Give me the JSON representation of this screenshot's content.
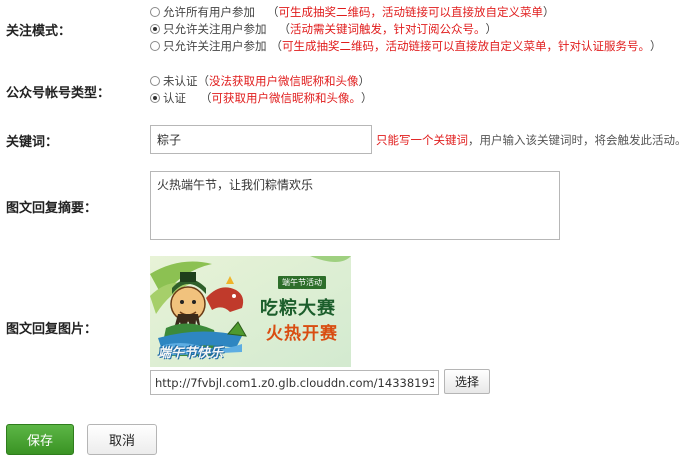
{
  "form": {
    "follow_mode": {
      "label": "关注模式：",
      "options": [
        {
          "text": "允许所有用户参加",
          "note": "可生成抽奖二维码，活动链接可以直接放自定义菜单",
          "checked": false,
          "note_color": "red"
        },
        {
          "text": "只允许关注用户参加",
          "note": "活动需关键词触发，针对订阅公众号。",
          "checked": true,
          "note_color": "red"
        },
        {
          "text": "只允许关注用户参加",
          "note": "可生成抽奖二维码，活动链接可以直接放自定义菜单，针对认证服务号。",
          "checked": false,
          "note_color": "red"
        }
      ]
    },
    "account_type": {
      "label": "公众号帐号类型：",
      "options": [
        {
          "text": "未认证",
          "note": "没法获取用户微信昵称和头像",
          "checked": false
        },
        {
          "text": "认证",
          "note": "可获取用户微信昵称和头像。",
          "checked": true
        }
      ]
    },
    "keyword": {
      "label": "关键词：",
      "value": "粽子",
      "hint_red": "只能写一个关键词",
      "hint_rest": "，用户输入该关键词时，将会触发此活动。"
    },
    "summary": {
      "label": "图文回复摘要：",
      "value": "火热端午节，让我们粽情欢乐"
    },
    "image": {
      "label": "图文回复图片：",
      "url_value": "http://7fvbjl.com1.z0.glb.clouddn.com/14338193",
      "select_label": "选择",
      "promo": {
        "tag": "端午节活动",
        "title": "吃粽大赛",
        "subtitle": "火热开赛",
        "logo_text": "端午节快乐"
      }
    }
  },
  "actions": {
    "save_label": "保存",
    "cancel_label": "取消"
  },
  "colors": {
    "accent_red": "#e01c1c",
    "save_green": "#4aa535"
  }
}
